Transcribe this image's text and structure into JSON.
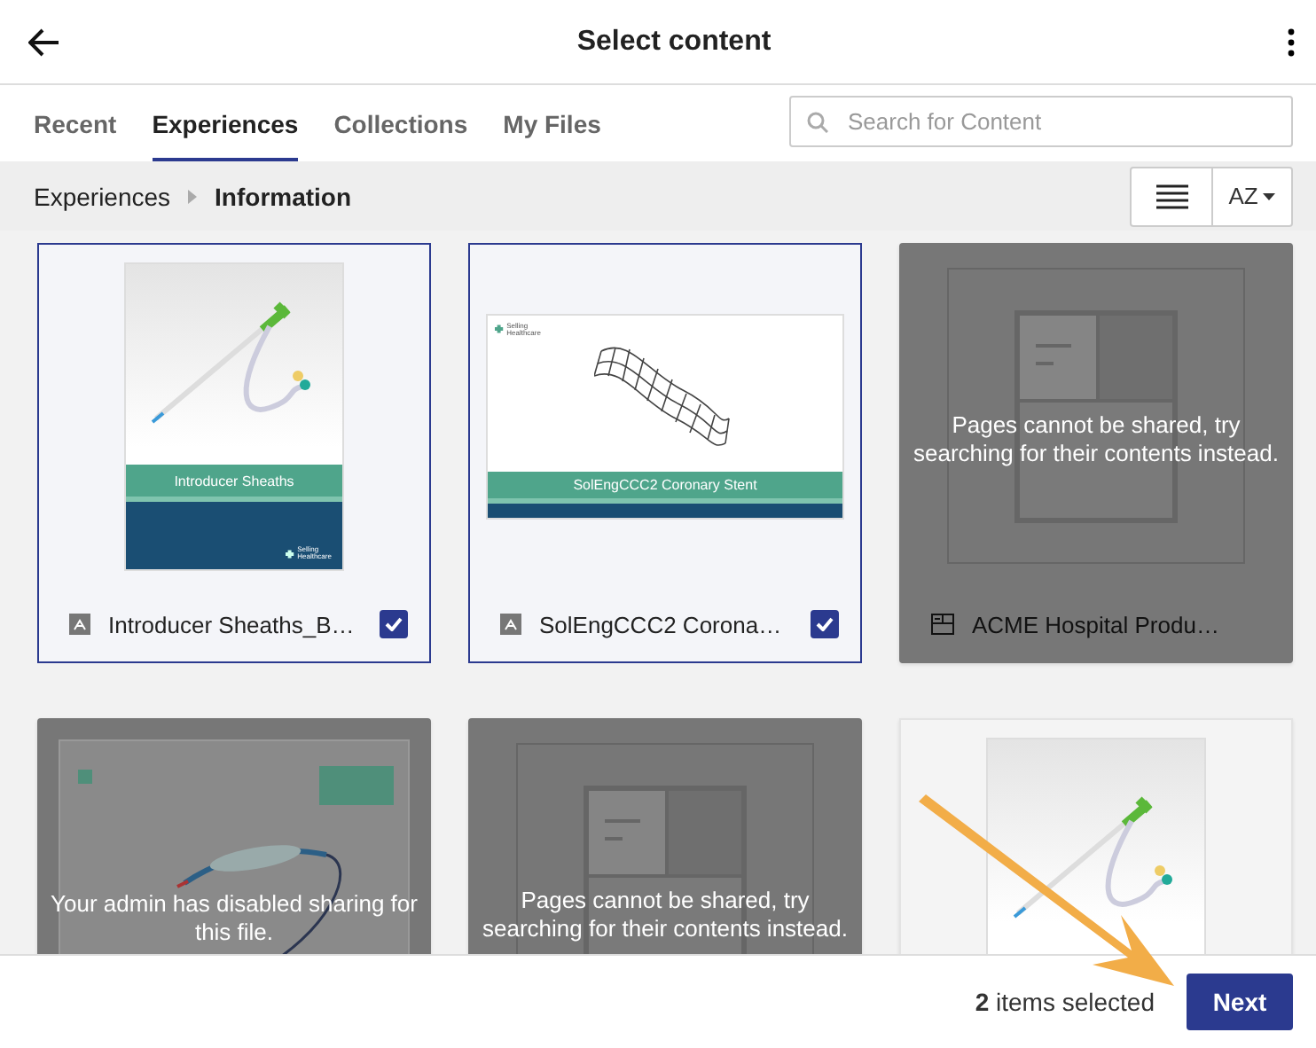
{
  "header": {
    "title": "Select content"
  },
  "tabs": [
    {
      "label": "Recent",
      "selected": false
    },
    {
      "label": "Experiences",
      "selected": true
    },
    {
      "label": "Collections",
      "selected": false
    },
    {
      "label": "My Files",
      "selected": false
    }
  ],
  "search": {
    "placeholder": "Search for Content"
  },
  "breadcrumb": [
    "Experiences",
    "Information"
  ],
  "sort_button": {
    "label": "AZ"
  },
  "cards": [
    {
      "kind": "document",
      "thumbnail": {
        "kind": "sheath",
        "banner": "Introducer Sheaths",
        "brand": "Selling Healthcare"
      },
      "title": "Introducer Sheaths_B…",
      "file_icon": {
        "kind": "pdf"
      },
      "selected": true
    },
    {
      "kind": "document",
      "thumbnail": {
        "kind": "stent",
        "banner": "SolEngCCC2 Coronary Stent",
        "brand": "Selling Healthcare"
      },
      "title": "SolEngCCC2 Corona…",
      "file_icon": {
        "kind": "pdf"
      },
      "selected": true
    },
    {
      "kind": "blocked",
      "thumbnail": {
        "kind": "page"
      },
      "message": "Pages cannot be shared, try searching for their contents instead.",
      "title": "ACME Hospital Produ…",
      "file_icon": {
        "kind": "page"
      }
    },
    {
      "kind": "blocked",
      "thumbnail": {
        "kind": "balloon"
      },
      "message": "Your admin has disabled sharing for this file."
    },
    {
      "kind": "blocked",
      "thumbnail": {
        "kind": "page"
      },
      "message": "Pages cannot be shared, try searching for their contents instead."
    },
    {
      "kind": "document",
      "thumbnail": {
        "kind": "sheath"
      }
    }
  ],
  "footer": {
    "status": "**2** items selected",
    "next_label": "Next"
  }
}
